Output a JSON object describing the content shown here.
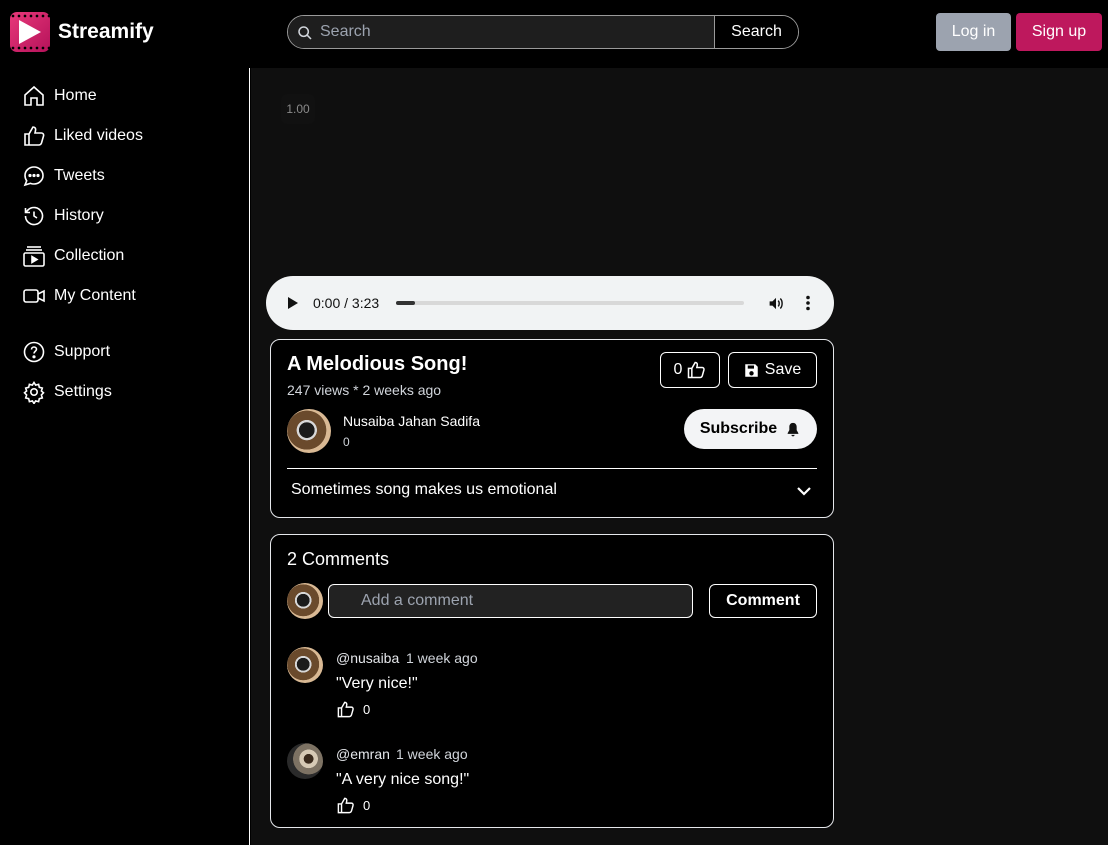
{
  "app": {
    "name": "Streamify"
  },
  "colors": {
    "accent": "#be185d",
    "login_bg": "#9ca3af",
    "background": "#000000"
  },
  "header": {
    "search_placeholder": "Search",
    "search_button": "Search",
    "login_button": "Log in",
    "signup_button": "Sign up"
  },
  "sidebar": {
    "items": [
      {
        "label": "Home",
        "icon": "home-icon"
      },
      {
        "label": "Liked videos",
        "icon": "thumbs-up-icon"
      },
      {
        "label": "Tweets",
        "icon": "chat-bubble-icon"
      },
      {
        "label": "History",
        "icon": "history-icon"
      },
      {
        "label": "Collection",
        "icon": "collection-icon"
      },
      {
        "label": "My Content",
        "icon": "camera-icon"
      },
      {
        "label": "Support",
        "icon": "help-icon"
      },
      {
        "label": "Settings",
        "icon": "gear-icon"
      }
    ]
  },
  "player": {
    "speed": "1.00",
    "time": "0:00 / 3:23",
    "progress": 0.055
  },
  "video": {
    "title": "A Melodious Song!",
    "meta": "247 views * 2 weeks ago",
    "likes": "0",
    "save_label": "Save",
    "channel": {
      "name": "Nusaiba Jahan Sadifa",
      "subscribers": "0"
    },
    "subscribe_label": "Subscribe",
    "description": "Sometimes song makes us emotional"
  },
  "comments": {
    "title": "2 Comments",
    "placeholder": "Add a comment",
    "button": "Comment",
    "items": [
      {
        "user": "@nusaiba",
        "time": "1 week ago",
        "text": "\"Very nice!\"",
        "likes": "0"
      },
      {
        "user": "@emran",
        "time": "1 week ago",
        "text": "\"A very nice song!\"",
        "likes": "0"
      }
    ]
  }
}
